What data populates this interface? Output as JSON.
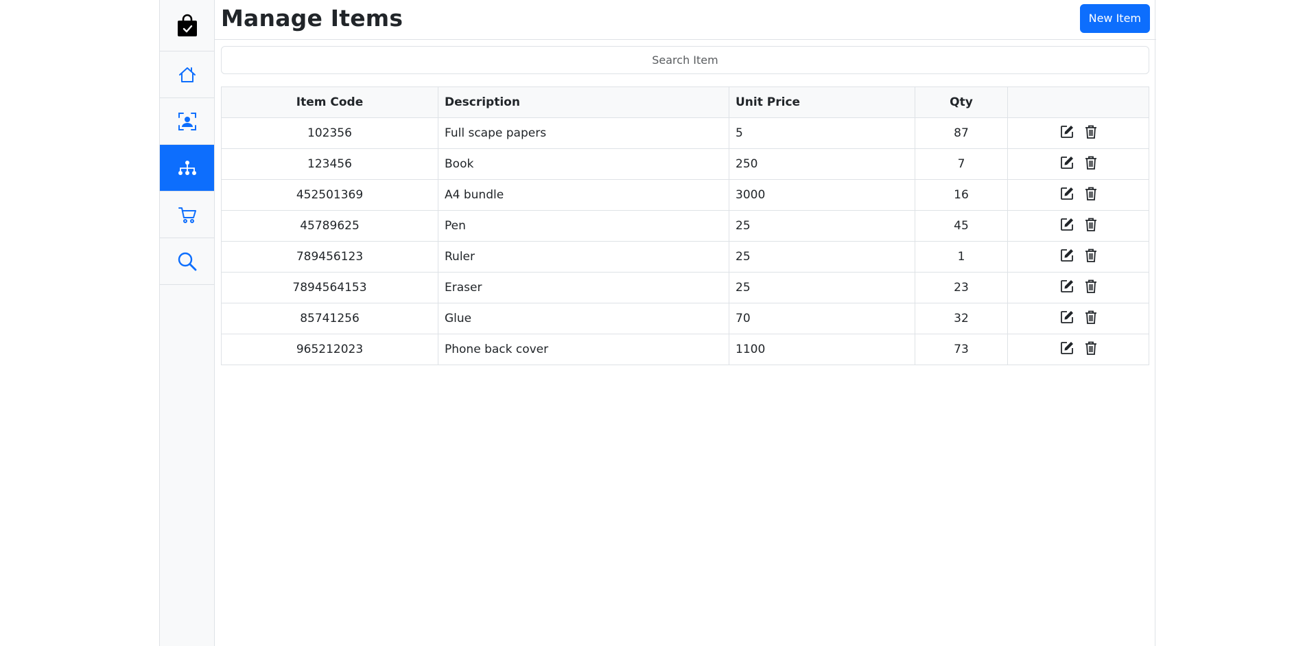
{
  "header": {
    "title": "Manage Items",
    "new_button": "New Item"
  },
  "search": {
    "placeholder": "Search Item"
  },
  "sidebar": {
    "items": [
      {
        "name": "logo",
        "icon": "shopping-bag-check-icon"
      },
      {
        "name": "home",
        "icon": "house-icon"
      },
      {
        "name": "customers",
        "icon": "person-badge-icon"
      },
      {
        "name": "items",
        "icon": "diagram-icon",
        "active": true
      },
      {
        "name": "orders",
        "icon": "cart-icon"
      },
      {
        "name": "search",
        "icon": "search-icon"
      }
    ]
  },
  "table": {
    "headers": [
      "Item Code",
      "Description",
      "Unit Price",
      "Qty",
      ""
    ],
    "rows": [
      {
        "code": "102356",
        "description": "Full scape papers",
        "price": "5",
        "qty": "87"
      },
      {
        "code": "123456",
        "description": "Book",
        "price": "250",
        "qty": "7"
      },
      {
        "code": "452501369",
        "description": "A4 bundle",
        "price": "3000",
        "qty": "16"
      },
      {
        "code": "45789625",
        "description": "Pen",
        "price": "25",
        "qty": "45"
      },
      {
        "code": "789456123",
        "description": "Ruler",
        "price": "25",
        "qty": "1"
      },
      {
        "code": "7894564153",
        "description": "Eraser",
        "price": "25",
        "qty": "23"
      },
      {
        "code": "85741256",
        "description": "Glue",
        "price": "70",
        "qty": "32"
      },
      {
        "code": "965212023",
        "description": "Phone back cover",
        "price": "1100",
        "qty": "73"
      }
    ]
  },
  "colors": {
    "primary": "#0d6efd",
    "sidebar_bg": "#f8f9fa",
    "border": "#dee2e6",
    "text": "#212529"
  }
}
